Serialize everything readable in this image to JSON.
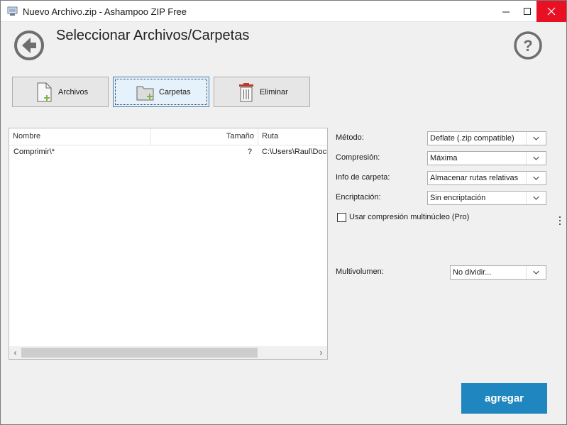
{
  "window": {
    "title": "Nuevo Archivo.zip - Ashampoo ZIP Free"
  },
  "header": {
    "title": "Seleccionar Archivos/Carpetas",
    "back_icon": "arrow-left-circle-icon",
    "help_icon": "question-circle-icon"
  },
  "toolbar": {
    "archivos_label": "Archivos",
    "carpetas_label": "Carpetas",
    "eliminar_label": "Eliminar"
  },
  "filelist": {
    "columns": [
      "Nombre",
      "Tamaño",
      "Ruta"
    ],
    "rows": [
      {
        "nombre": "Comprimir\\*",
        "tamano": "?",
        "ruta": "C:\\Users\\Raul\\Documents"
      }
    ]
  },
  "options": {
    "metodo": {
      "label": "Método:",
      "value": "Deflate (.zip compatible)"
    },
    "compresion": {
      "label": "Compresión:",
      "value": "Máxima"
    },
    "info_carpeta": {
      "label": "Info de carpeta:",
      "value": "Almacenar rutas relativas"
    },
    "encriptacion": {
      "label": "Encriptación:",
      "value": "Sin encriptación"
    },
    "multinucleo": {
      "label": "Usar compresión multinúcleo (Pro)",
      "checked": false
    },
    "multivolumen": {
      "label": "Multivolumen:",
      "value": "No dividir..."
    }
  },
  "actions": {
    "add_label": "agregar"
  },
  "colors": {
    "accent": "#1f86bf",
    "close": "#e81123",
    "add_icon_green": "#7ab648",
    "delete_icon_red": "#c0392b"
  }
}
